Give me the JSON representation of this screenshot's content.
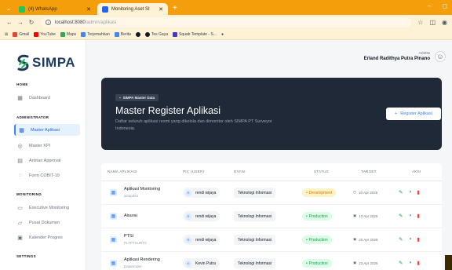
{
  "browser": {
    "tabs": [
      {
        "label": "(4) WhatsApp",
        "fav_color": "#22c55e"
      },
      {
        "label": "Monitoring Aset SI",
        "fav_color": "#2563eb"
      }
    ],
    "url_host": "localhost:8080",
    "url_path": "/admin/aplikasi",
    "bookmarks": [
      {
        "label": "Gmail",
        "color": "#ea4335"
      },
      {
        "label": "YouTube",
        "color": "#ff0000"
      },
      {
        "label": "Maps",
        "color": "#34a853"
      },
      {
        "label": "Terjemahkan",
        "color": "#4285f4"
      },
      {
        "label": "Berita",
        "color": "#4285f4"
      },
      {
        "label": "",
        "color": "#111827"
      },
      {
        "label": "Tes Gaya",
        "color": "#111827"
      },
      {
        "label": "Squab Template - S...",
        "color": "#4338ca"
      }
    ]
  },
  "sidebar": {
    "logo": "SIMPA",
    "sections": [
      {
        "title": "HOME",
        "items": [
          {
            "label": "Dashboard",
            "icon": "grid-icon"
          }
        ]
      },
      {
        "title": "ADMINISTRATOR",
        "items": [
          {
            "label": "Master Aplikasi",
            "icon": "apps-icon",
            "active": true
          },
          {
            "label": "Master KPI",
            "icon": "target-icon"
          },
          {
            "label": "Antrian Approval",
            "icon": "clipboard-icon"
          },
          {
            "label": "Form COBIT-19",
            "icon": "circle-check-icon"
          }
        ]
      },
      {
        "title": "MONITORING",
        "items": [
          {
            "label": "Executive Monitoring",
            "icon": "monitor-icon"
          },
          {
            "label": "Pusat Dokumen",
            "icon": "folder-icon"
          },
          {
            "label": "Kalender Progres",
            "icon": "calendar-icon"
          }
        ]
      },
      {
        "title": "SETTINGS",
        "items": []
      }
    ]
  },
  "header": {
    "role": "ADMIN",
    "user_name": "Erland Radithya Putra Pinano"
  },
  "hero": {
    "badge": "SIMPA Master Data",
    "title": "Master Register Aplikasi",
    "description": "Daftar seluruh aplikasi resmi yang dikelola dan dimonitor oleh SIMPA PT Surveyor Indonesia.",
    "button": "Register Aplikasi"
  },
  "table": {
    "columns": [
      "NAMA APLIKASI",
      "PIC (USER)",
      "DIVISI",
      "STATUS",
      "TARGET",
      "AKSI"
    ],
    "rows": [
      {
        "name": "Aplikasi Monitoring",
        "code": "aisapdita",
        "pic": "rendi wijaya",
        "division": "Teknologi Informasi",
        "status": "Development",
        "target": "10 Apr 2026"
      },
      {
        "name": "Aisurai",
        "code": "",
        "pic": "rendi wijaya",
        "division": "Teknologi Informasi",
        "status": "Production",
        "target": "10 Apr 2026"
      },
      {
        "name": "PTSI",
        "code": "PLTPTSURTS",
        "pic": "rendi wijaya",
        "division": "Teknologi Informasi",
        "status": "Production",
        "target": "20 Apr 2026"
      },
      {
        "name": "Aplikasi Rendering",
        "code": "Datarender",
        "pic": "Kevin Putra",
        "division": "Teknologi Informasi",
        "status": "Production",
        "target": "23 Apr 2026"
      }
    ]
  },
  "colors": {
    "accent": "#3b82f6",
    "hero_bg": "#1f2937",
    "chrome": "#f59e0b"
  }
}
